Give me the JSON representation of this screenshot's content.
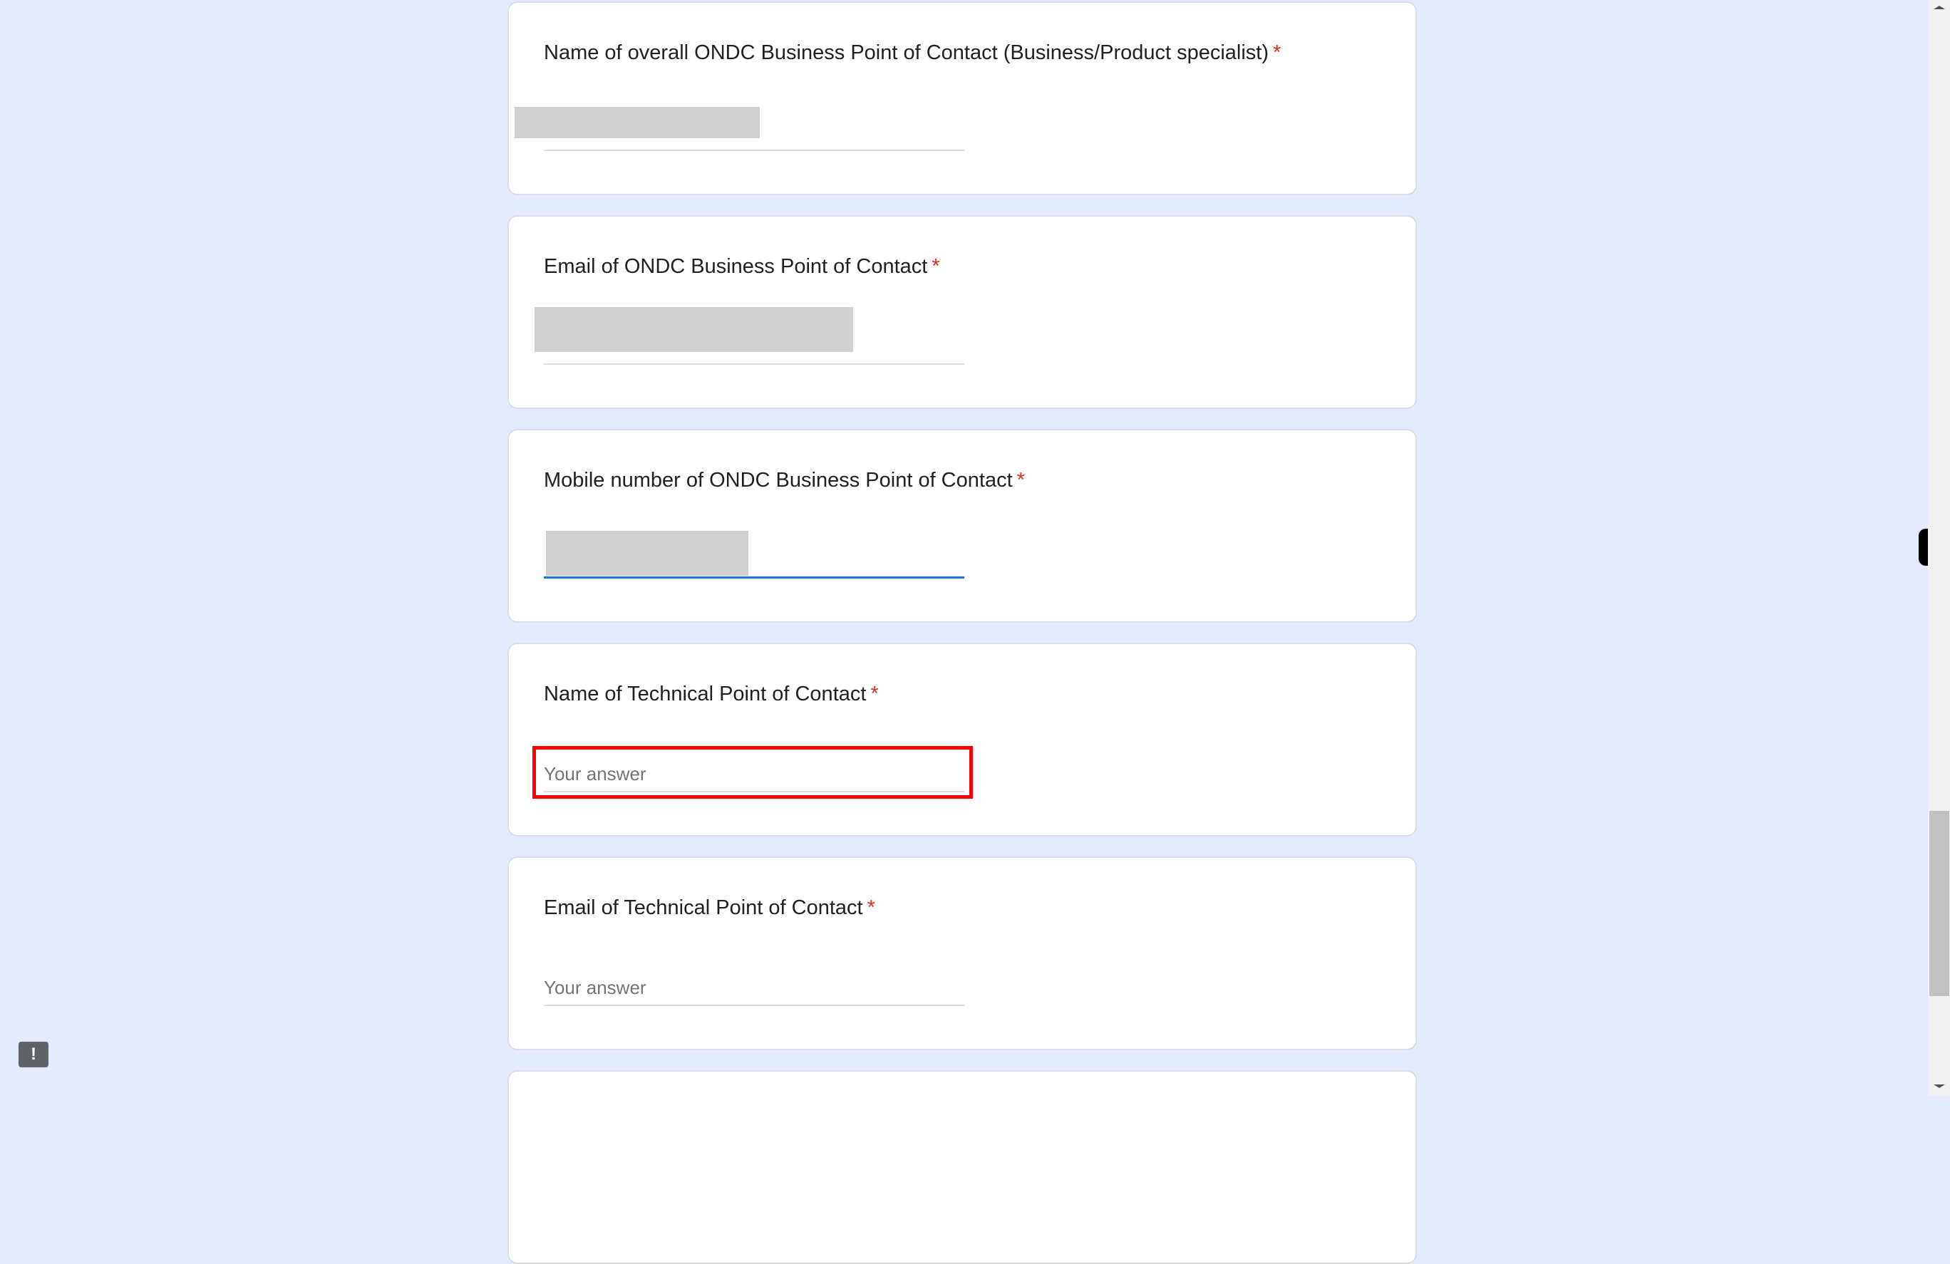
{
  "questions": [
    {
      "label": "Name of overall ONDC Business Point of Contact (Business/Product specialist)",
      "required": "*",
      "value": "[redacted]"
    },
    {
      "label": "Email of ONDC Business Point of Contact",
      "required": "*",
      "value": "[redacted]"
    },
    {
      "label": "Mobile number of ONDC Business Point of Contact",
      "required": "*",
      "value": "[redacted]"
    },
    {
      "label": "Name of Technical Point of Contact",
      "required": "*",
      "placeholder": "Your answer"
    },
    {
      "label": "Email of Technical Point of Contact",
      "required": "*",
      "placeholder": "Your answer"
    }
  ],
  "feedback": {
    "icon": "feedback-exclamation-icon",
    "glyph": "!"
  },
  "colors": {
    "background": "#e3ebfc",
    "required": "#d93025",
    "focus": "#1a73e8",
    "highlight": "#ff0000"
  }
}
